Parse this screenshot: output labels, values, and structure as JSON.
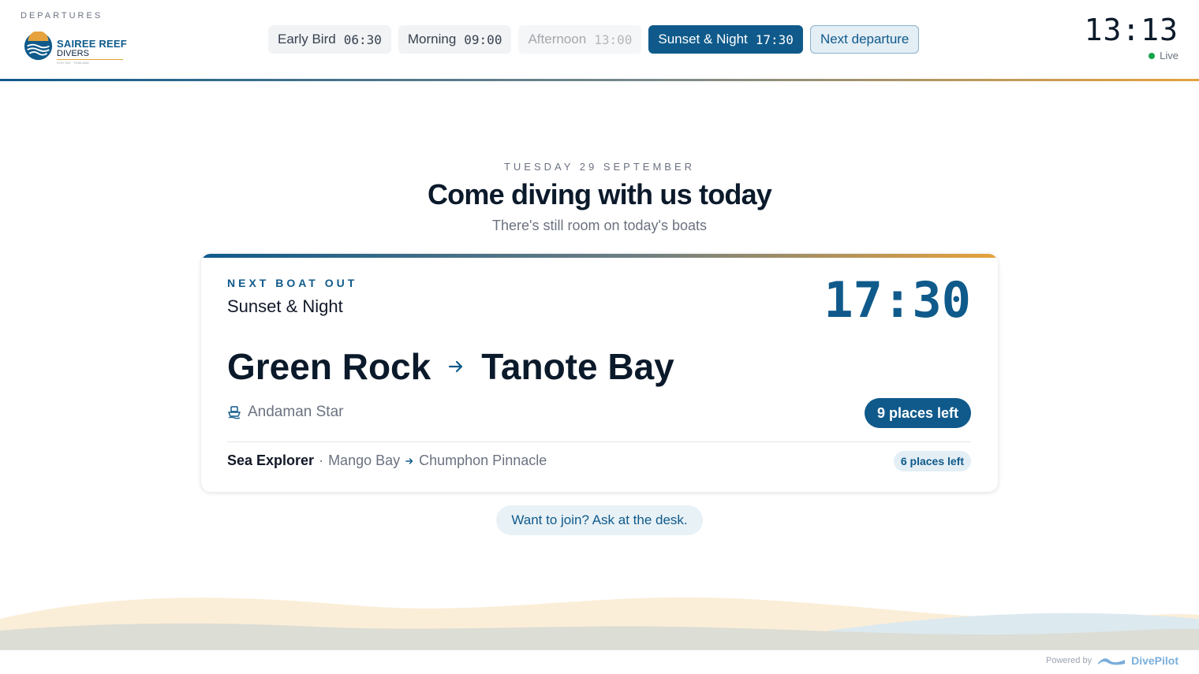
{
  "header": {
    "eyebrow": "DEPARTURES",
    "logo": {
      "name": "SAIREE REEF",
      "sub": "DIVERS",
      "tagline": "KOH TAO · THAILAND"
    },
    "slots": [
      {
        "label": "Early Bird",
        "time": "06:30",
        "state": "default"
      },
      {
        "label": "Morning",
        "time": "09:00",
        "state": "default"
      },
      {
        "label": "Afternoon",
        "time": "13:00",
        "state": "muted"
      },
      {
        "label": "Sunset & Night",
        "time": "17:30",
        "state": "active"
      }
    ],
    "next_label": "Next departure",
    "clock": "13:13",
    "live_label": "Live"
  },
  "hero": {
    "date": "TUESDAY 29 SEPTEMBER",
    "title": "Come diving with us today",
    "subtitle": "There's still room on today's boats"
  },
  "card": {
    "eyebrow": "NEXT BOAT OUT",
    "slot": "Sunset & Night",
    "time": "17:30",
    "route_from": "Green Rock",
    "route_to": "Tanote Bay",
    "boat": "Andaman Star",
    "places": "9 places left",
    "other": {
      "boat": "Sea Explorer",
      "from": "Mango Bay",
      "to": "Chumphon Pinnacle",
      "places": "6 places left"
    }
  },
  "join_label": "Want to join? Ask at the desk.",
  "footer": {
    "powered_by": "Powered by",
    "brand": "DivePilot"
  },
  "colors": {
    "primary": "#0f5a8b",
    "accent": "#e6a23c",
    "live": "#16a34a"
  },
  "icons": [
    "logo-icon",
    "live-dot-icon",
    "arrow-right-icon",
    "boat-icon",
    "divepilot-logo-icon"
  ]
}
